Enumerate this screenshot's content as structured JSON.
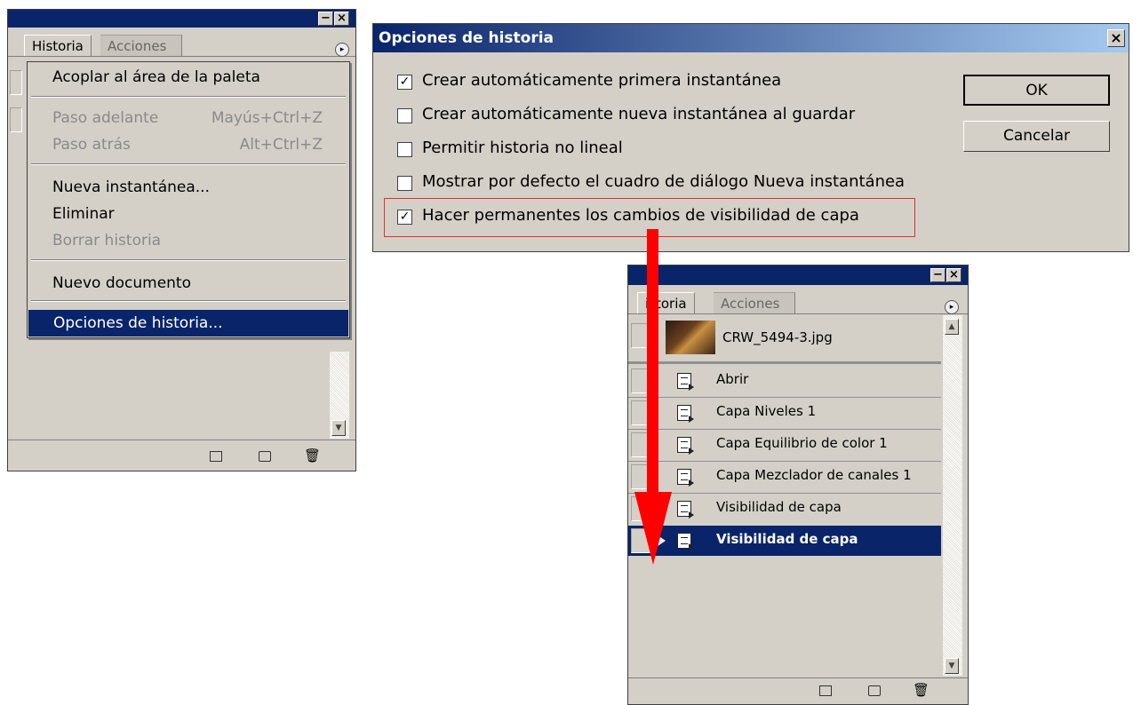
{
  "left_panel": {
    "tabs": [
      "Historia",
      "Acciones"
    ],
    "menu": {
      "items": [
        {
          "label": "Acoplar al área de la paleta",
          "shortcut": "",
          "disabled": false
        },
        {
          "label": "Paso adelante",
          "shortcut": "Mayús+Ctrl+Z",
          "disabled": true
        },
        {
          "label": "Paso atrás",
          "shortcut": "Alt+Ctrl+Z",
          "disabled": true
        },
        {
          "label": "Nueva instantánea...",
          "shortcut": "",
          "disabled": false
        },
        {
          "label": "Eliminar",
          "shortcut": "",
          "disabled": false
        },
        {
          "label": "Borrar historia",
          "shortcut": "",
          "disabled": true
        },
        {
          "label": "Nuevo documento",
          "shortcut": "",
          "disabled": false
        },
        {
          "label": "Opciones de historia...",
          "shortcut": "",
          "disabled": false,
          "selected": true
        }
      ]
    }
  },
  "dialog": {
    "title": "Opciones de historia",
    "close": "×",
    "options": [
      {
        "label": "Crear automáticamente primera instantánea",
        "checked": true
      },
      {
        "label": "Crear automáticamente nueva instantánea al guardar",
        "checked": false
      },
      {
        "label": "Permitir historia no lineal",
        "checked": false
      },
      {
        "label": "Mostrar por defecto el cuadro de diálogo Nueva instantánea",
        "checked": false
      },
      {
        "label": "Hacer permanentes los cambios de visibilidad de capa",
        "checked": true
      }
    ],
    "ok_label": "OK",
    "cancel_label": "Cancelar"
  },
  "right_panel": {
    "tabs": [
      "istoria",
      "Acciones"
    ],
    "snapshot": "CRW_5494-3.jpg",
    "states": [
      "Abrir",
      "Capa Niveles 1",
      "Capa Equilibrio de color 1",
      "Capa Mezclador de canales 1",
      "Visibilidad de capa",
      "Visibilidad de capa"
    ],
    "selected_state_index": 5
  },
  "colors": {
    "titlebar": "#0a246a",
    "panel_bg": "#d4d0c8",
    "highlight_box": "#e03030",
    "arrow": "#ff0000"
  }
}
